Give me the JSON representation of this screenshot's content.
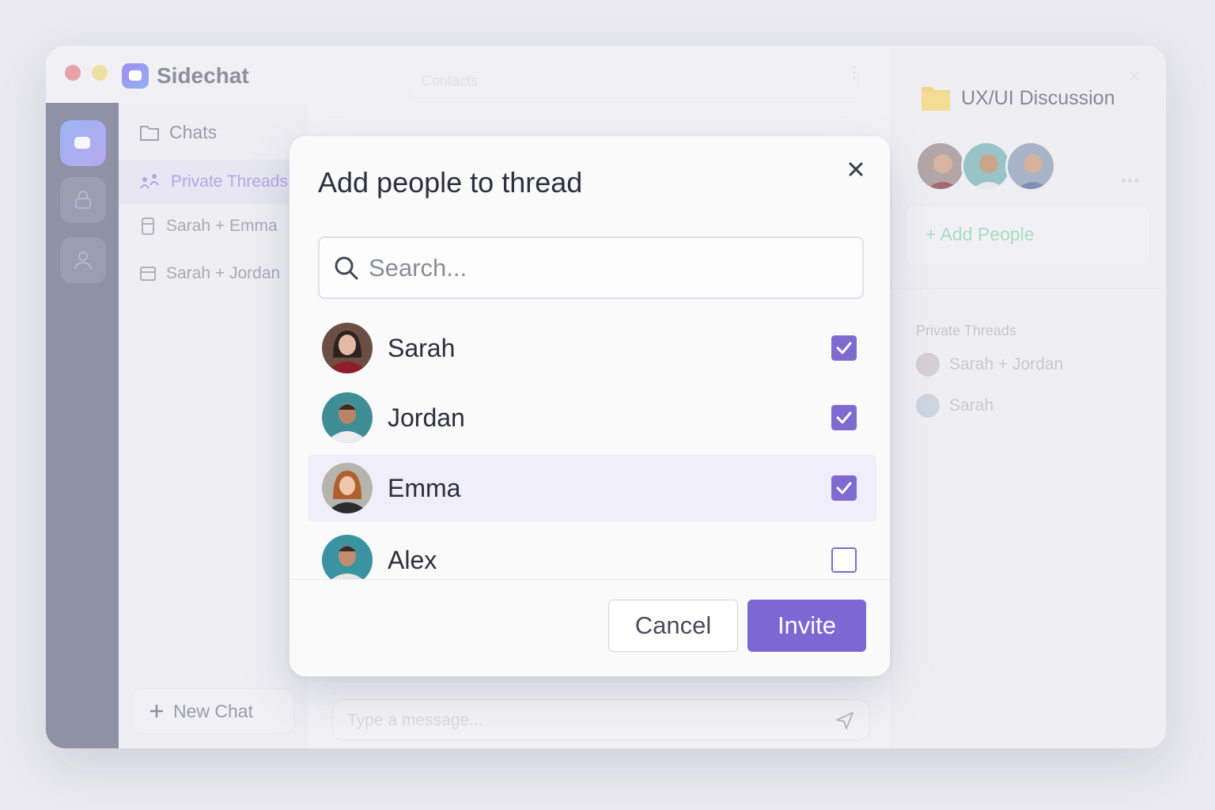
{
  "app": {
    "name": "Sidechat",
    "contacts_placeholder": "Contacts"
  },
  "nav": {
    "chats_label": "Chats",
    "private_threads_label": "Private Threads",
    "threads": [
      "Sarah + Emma",
      "Sarah + Jordan"
    ],
    "new_chat_label": "New Chat"
  },
  "composer": {
    "placeholder": "Type a message..."
  },
  "right_panel": {
    "title": "UX/UI Discussion",
    "add_people_label": "+ Add People",
    "section_label": "Private Threads",
    "threads": [
      "Sarah + Jordan",
      "Sarah"
    ]
  },
  "modal": {
    "title": "Add people to thread",
    "search_placeholder": "Search...",
    "people": [
      {
        "name": "Sarah",
        "checked": true
      },
      {
        "name": "Jordan",
        "checked": true
      },
      {
        "name": "Emma",
        "checked": true,
        "highlighted": true
      },
      {
        "name": "Alex",
        "checked": false
      }
    ],
    "cancel_label": "Cancel",
    "invite_label": "Invite"
  },
  "colors": {
    "accent": "#7c68d3",
    "checkbox": "#7e6bd0",
    "row_highlight": "#f1eefb"
  }
}
